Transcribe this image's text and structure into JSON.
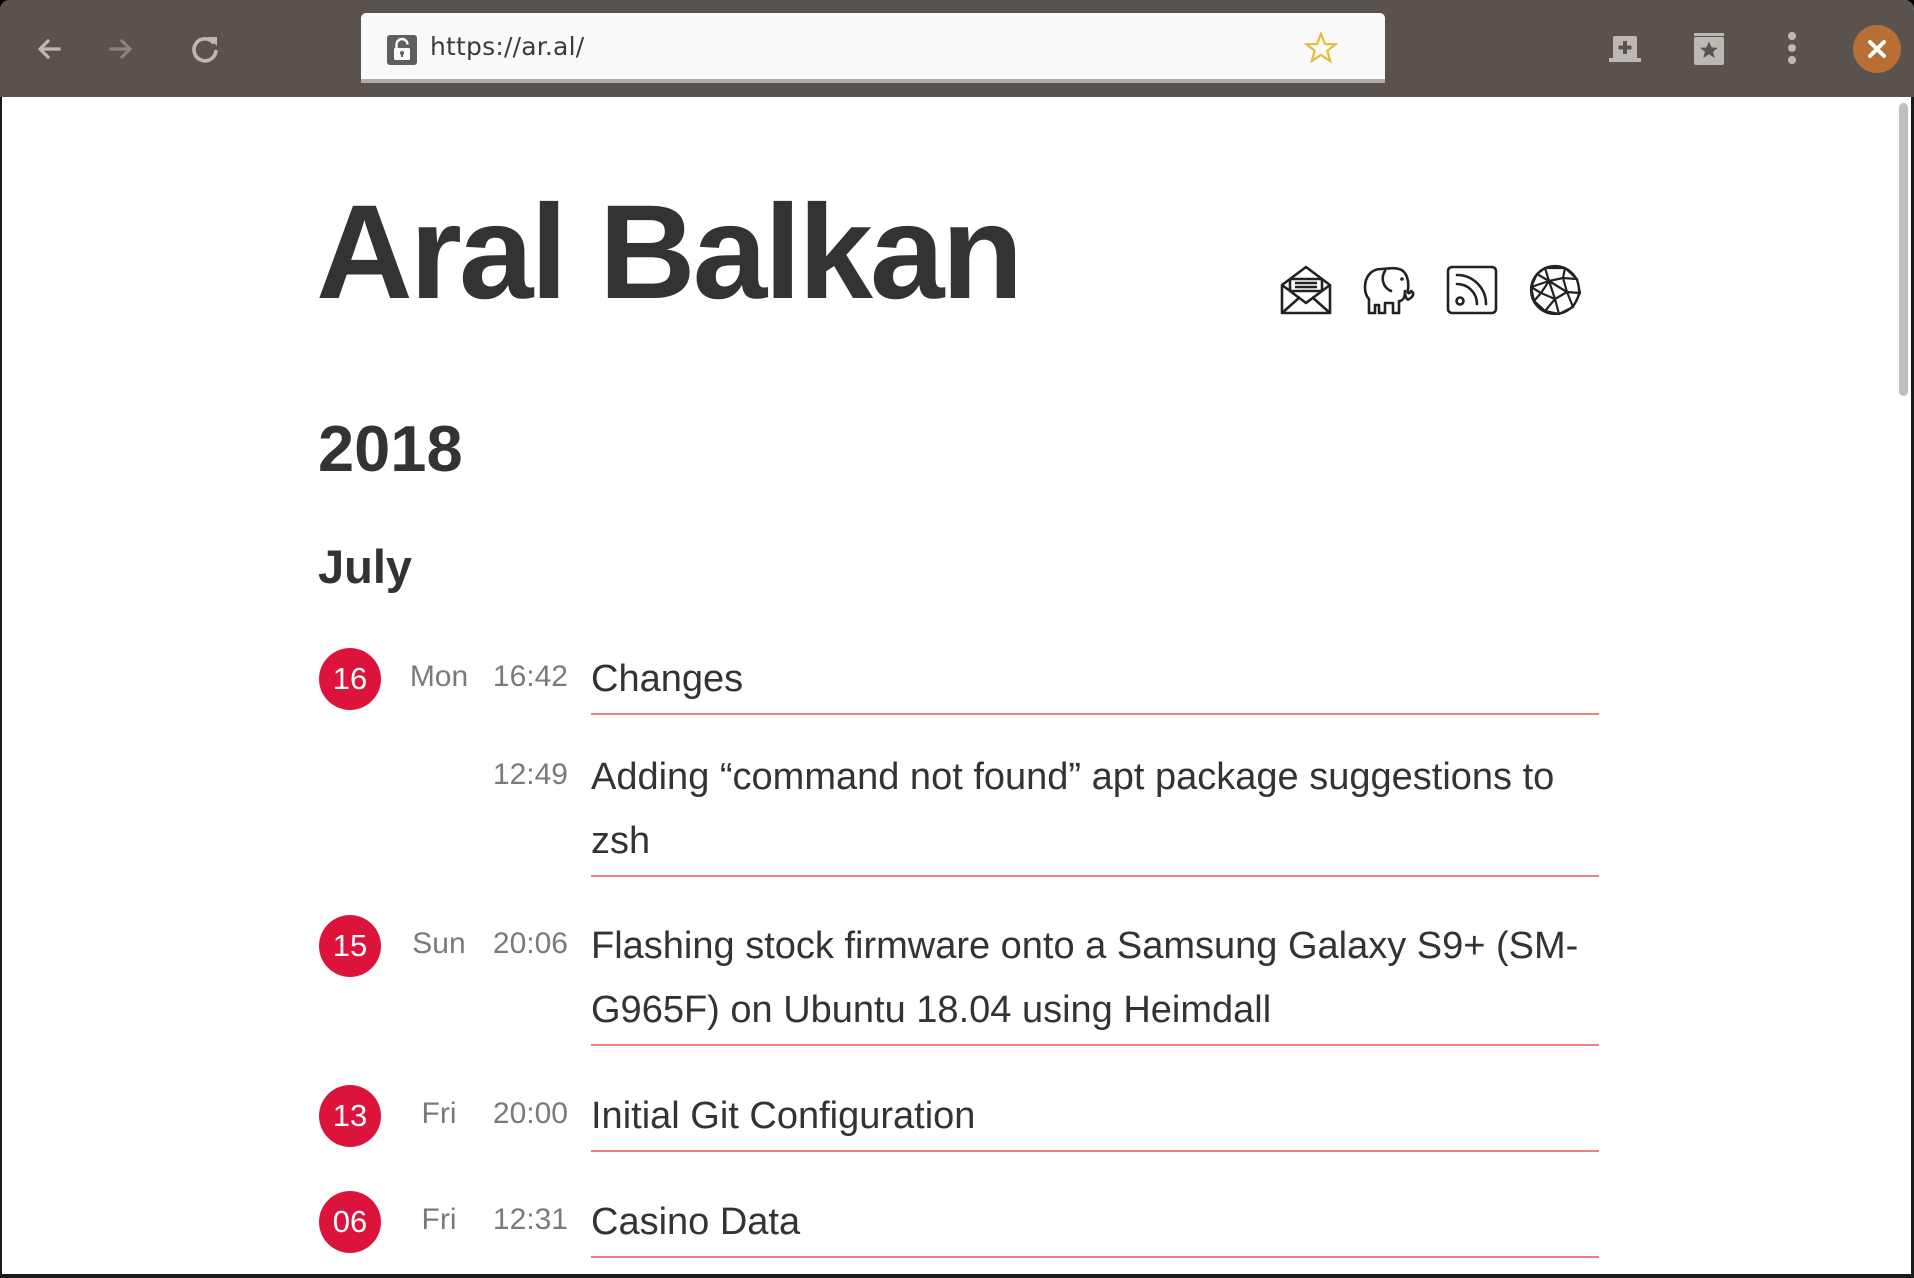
{
  "browser": {
    "url": "https://ar.al/",
    "buttons": {
      "back": "back-arrow",
      "forward": "forward-arrow",
      "reload": "reload",
      "new_tab": "new-tab",
      "bookmarks": "bookmarks",
      "menu": "more-vertical",
      "close": "close"
    },
    "colors": {
      "toolbar": "#5a524c",
      "close_button": "#b86f36",
      "bookmark_star": "#e8b93d"
    }
  },
  "page": {
    "site_title": "Aral Balkan",
    "social_links": [
      {
        "icon": "email-envelope",
        "label": "Email"
      },
      {
        "icon": "mastodon-elephant",
        "label": "Mastodon"
      },
      {
        "icon": "rss-feed",
        "label": "RSS"
      },
      {
        "icon": "geodesic-sphere",
        "label": "Indienet"
      }
    ],
    "year": "2018",
    "month": "July",
    "accent_color": "#dc143c",
    "posts": [
      {
        "date_num": "16",
        "day": "Mon",
        "time": "16:42",
        "title": "Changes"
      },
      {
        "date_num": "",
        "day": "",
        "time": "12:49",
        "title": "Adding “command not found” apt package suggestions to zsh"
      },
      {
        "date_num": "15",
        "day": "Sun",
        "time": "20:06",
        "title": "Flashing stock firmware onto a Samsung Galaxy S9+ (SM-G965F) on Ubuntu 18.04 using Heimdall"
      },
      {
        "date_num": "13",
        "day": "Fri",
        "time": "20:00",
        "title": "Initial Git Configuration"
      },
      {
        "date_num": "06",
        "day": "Fri",
        "time": "12:31",
        "title": "Casino Data"
      }
    ]
  }
}
